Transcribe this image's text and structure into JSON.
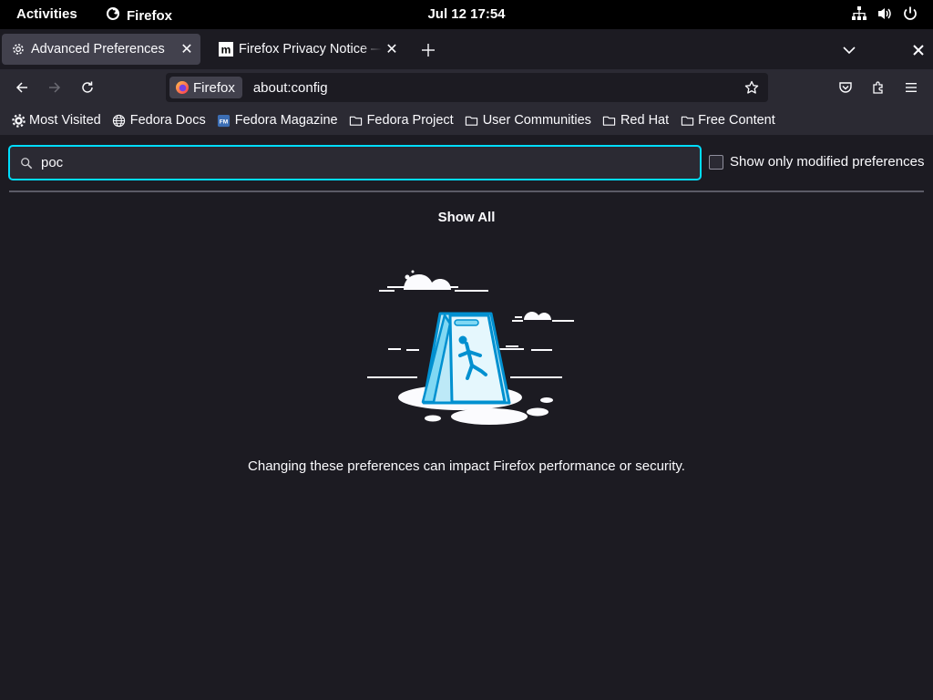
{
  "topbar": {
    "activities": "Activities",
    "app_name": "Firefox",
    "clock": "Jul 12  17:54"
  },
  "tabs": [
    {
      "title": "Advanced Preferences",
      "icon": "gear-icon",
      "active": true
    },
    {
      "title": "Firefox Privacy Notice — Mozilla",
      "icon": "mozilla-m-icon",
      "active": false
    }
  ],
  "urlbar": {
    "identity_label": "Firefox",
    "url": "about:config"
  },
  "bookmarks": [
    {
      "label": "Most Visited",
      "icon": "gear-icon"
    },
    {
      "label": "Fedora Docs",
      "icon": "globe-icon"
    },
    {
      "label": "Fedora Magazine",
      "icon": "fedora-magazine-icon"
    },
    {
      "label": "Fedora Project",
      "icon": "folder-icon"
    },
    {
      "label": "User Communities",
      "icon": "folder-icon"
    },
    {
      "label": "Red Hat",
      "icon": "folder-icon"
    },
    {
      "label": "Free Content",
      "icon": "folder-icon"
    }
  ],
  "config": {
    "search_value": "poc",
    "modified_label": "Show only modified preferences",
    "show_all": "Show All",
    "warning": "Changing these preferences can impact Firefox performance or security."
  },
  "colors": {
    "accent": "#00ddff",
    "background": "#1c1b22",
    "toolbar": "#2b2a33"
  }
}
